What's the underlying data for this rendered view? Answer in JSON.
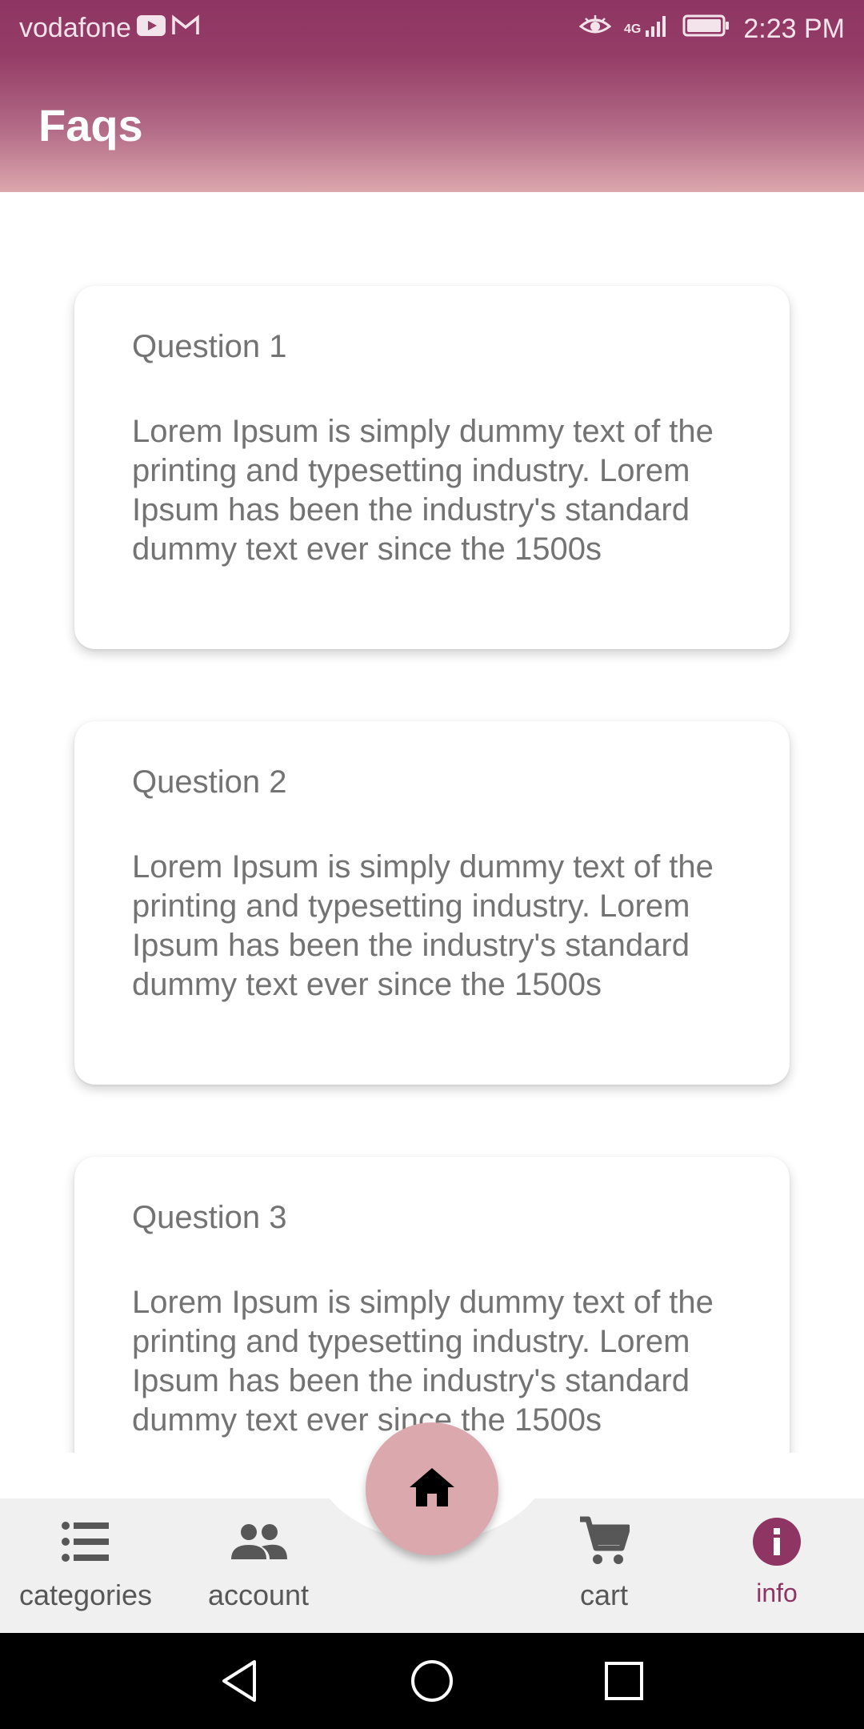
{
  "status_bar": {
    "carrier": "vodafone",
    "network": "4G",
    "time": "2:23 PM"
  },
  "app_bar": {
    "title": "Faqs"
  },
  "faqs": [
    {
      "question": "Question 1",
      "answer": "Lorem Ipsum is simply dummy text of the printing and typesetting industry. Lorem Ipsum has been the industry's standard dummy text ever since the 1500s"
    },
    {
      "question": "Question 2",
      "answer": "Lorem Ipsum is simply dummy text of the printing and typesetting industry. Lorem Ipsum has been the industry's standard dummy text ever since the 1500s"
    },
    {
      "question": "Question 3",
      "answer": "Lorem Ipsum is simply dummy text of the printing and typesetting industry. Lorem Ipsum has been the industry's standard dummy text ever since the 1500s"
    }
  ],
  "bottom_nav": {
    "items": [
      {
        "label": "categories",
        "icon": "list-icon"
      },
      {
        "label": "account",
        "icon": "people-icon"
      },
      {
        "label": "cart",
        "icon": "cart-icon"
      },
      {
        "label": "info",
        "icon": "info-icon",
        "active": true
      }
    ],
    "fab_icon": "home-icon"
  },
  "colors": {
    "brand": "#8e3563",
    "fab": "#dba8ad",
    "text_muted": "#737373",
    "nav_background": "#f0f0f0"
  }
}
